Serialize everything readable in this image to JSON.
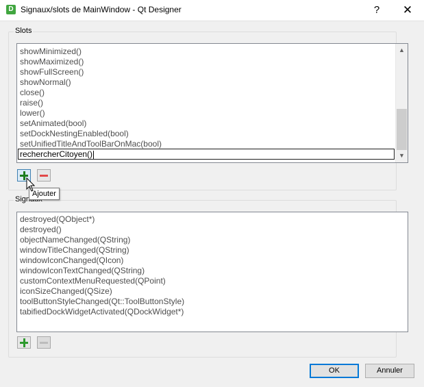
{
  "window": {
    "title": "Signaux/slots de MainWindow - Qt Designer",
    "app_icon_letter": "D",
    "help_label": "?",
    "close_label": "✕"
  },
  "slots": {
    "group_title": "Slots",
    "items": [
      "showMinimized()",
      "showMaximized()",
      "showFullScreen()",
      "showNormal()",
      "close()",
      "raise()",
      "lower()",
      "setAnimated(bool)",
      "setDockNestingEnabled(bool)",
      "setUnifiedTitleAndToolBarOnMac(bool)"
    ],
    "editing_value": "rechercherCitoyen()",
    "add_tooltip": "Ajouter"
  },
  "signals": {
    "group_title": "Signaux",
    "items": [
      "destroyed(QObject*)",
      "destroyed()",
      "objectNameChanged(QString)",
      "windowTitleChanged(QString)",
      "windowIconChanged(QIcon)",
      "windowIconTextChanged(QString)",
      "customContextMenuRequested(QPoint)",
      "iconSizeChanged(QSize)",
      "toolButtonStyleChanged(Qt::ToolButtonStyle)",
      "tabifiedDockWidgetActivated(QDockWidget*)"
    ]
  },
  "buttons": {
    "ok": "OK",
    "cancel": "Annuler"
  },
  "colors": {
    "accent": "#0078d7",
    "add_green": "#2e9a2e",
    "remove_red": "#e24848"
  }
}
